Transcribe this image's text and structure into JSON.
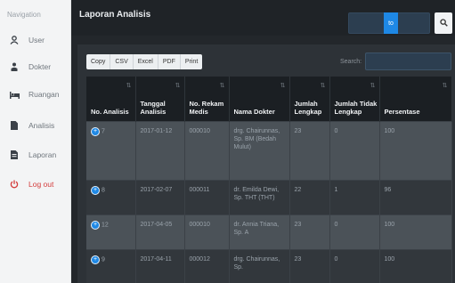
{
  "sidebar": {
    "title": "Navigation",
    "items": [
      {
        "label": "User",
        "icon": "user-icon"
      },
      {
        "label": "Dokter",
        "icon": "doctor-icon"
      },
      {
        "label": "Ruangan",
        "icon": "bed-icon"
      },
      {
        "label": "Analisis",
        "icon": "document-icon"
      },
      {
        "label": "Laporan",
        "icon": "report-icon"
      },
      {
        "label": "Log out",
        "icon": "power-icon"
      }
    ]
  },
  "header": {
    "title": "Laporan Analisis",
    "range_separator": "to"
  },
  "toolbar": {
    "buttons": [
      "Copy",
      "CSV",
      "Excel",
      "PDF",
      "Print"
    ],
    "search_label": "Search:",
    "search_value": ""
  },
  "table": {
    "columns": [
      "No. Analisis",
      "Tanggal Analisis",
      "No. Rekam Medis",
      "Nama Dokter",
      "Jumlah Lengkap",
      "Jumlah Tidak Lengkap",
      "Persentase"
    ],
    "rows": [
      {
        "no": "7",
        "tanggal": "2017-01-12",
        "rekam": "000010",
        "dokter": "drg. Chairunnas, Sp. BM (Bedah Mulut)",
        "lengkap": "23",
        "tidak": "0",
        "persen": "100"
      },
      {
        "no": "8",
        "tanggal": "2017-02-07",
        "rekam": "000011",
        "dokter": "dr. Emilda Dewi, Sp. THT (THT)",
        "lengkap": "22",
        "tidak": "1",
        "persen": "96"
      },
      {
        "no": "12",
        "tanggal": "2017-04-05",
        "rekam": "000010",
        "dokter": "dr. Annia Triana, Sp. A",
        "lengkap": "23",
        "tidak": "0",
        "persen": "100"
      },
      {
        "no": "9",
        "tanggal": "2017-04-11",
        "rekam": "000012",
        "dokter": "drg. Chairunnas, Sp.",
        "lengkap": "23",
        "tidak": "0",
        "persen": "100"
      }
    ]
  }
}
